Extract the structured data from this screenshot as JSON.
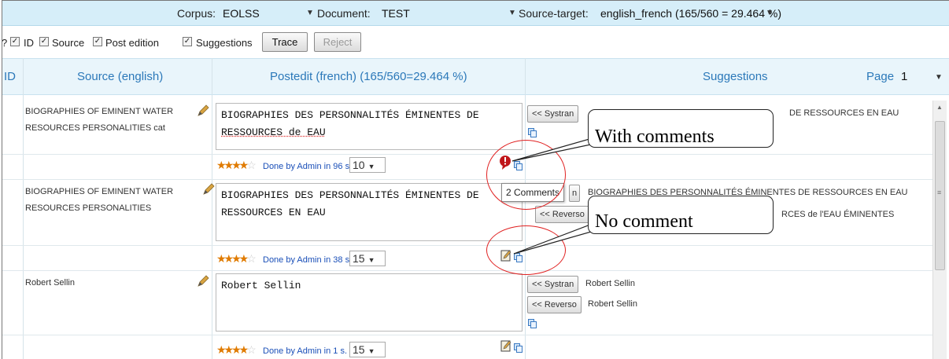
{
  "topbar": {
    "corpus_label": "Corpus:",
    "corpus_value": "EOLSS",
    "document_label": "Document:",
    "document_value": "TEST",
    "source_target_label": "Source-target:",
    "source_target_value": "english_french (165/560 = 29.464 %)"
  },
  "options": {
    "qmark": "?",
    "id_label": "ID",
    "source_label": "Source",
    "post_edition_label": "Post edition",
    "suggestions_label": "Suggestions",
    "check": "✓",
    "trace_button": "Trace",
    "reject_button": "Reject"
  },
  "header": {
    "id_col": "ID",
    "source_col": "Source (english)",
    "postedit_col": "Postedit (french) (165/560=29.464 %)",
    "suggestions_col": "Suggestions",
    "page_label": "Page",
    "page_value": "1"
  },
  "rows": [
    {
      "source": "BIOGRAPHIES OF EMINENT WATER RESOURCES PERSONALITIES cat",
      "postedit_line1": "BIOGRAPHIES DES PERSONNALITÉS ÉMINENTES DE",
      "postedit_line2": "RESSOURCES de EAU",
      "done_text": "Done by Admin in 96 s.",
      "score": "10",
      "systran_button": "<< Systran",
      "systran_text": "DE RESSOURCES EN EAU"
    },
    {
      "source": "BIOGRAPHIES OF EMINENT WATER RESOURCES PERSONALITIES",
      "postedit_line1": "BIOGRAPHIES DES PERSONNALITÉS ÉMINENTES DE",
      "postedit_line2": "RESSOURCES EN EAU",
      "done_text": "Done by Admin in 38 s.",
      "score": "15",
      "systran_button": "n",
      "systran_text": "BIOGRAPHIES DES PERSONNALITÉS ÉMINENTES DE RESSOURCES EN EAU",
      "reverso_button": "<< Reverso",
      "reverso_text": "RCES de l'EAU ÉMINENTES"
    },
    {
      "source": "Robert Sellin",
      "postedit_line1": "Robert Sellin",
      "done_text": "Done by Admin in 1 s.",
      "score": "15",
      "systran_button": "<< Systran",
      "systran_text": "Robert Sellin",
      "reverso_button": "<< Reverso",
      "reverso_text": "Robert Sellin"
    }
  ],
  "tooltip": "2 Comments",
  "annotations": {
    "with_comments": "With comments",
    "no_comment": "No comment"
  },
  "colors": {
    "accent_blue": "#2b78b9",
    "star_orange": "#e07b00",
    "highlight_red": "#e02020",
    "topbar_bg": "#d6eef9"
  }
}
